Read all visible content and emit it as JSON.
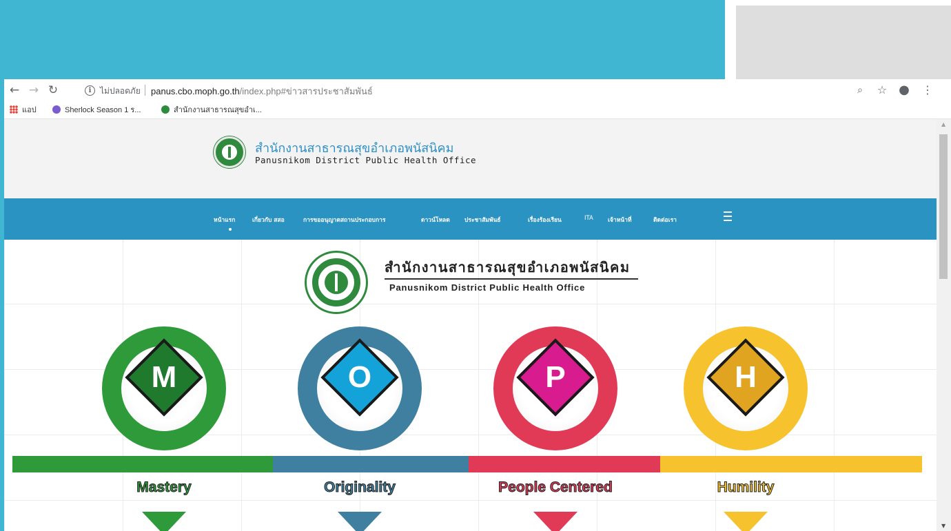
{
  "browser": {
    "security_label": "ไม่ปลอดภัย",
    "url_host": "panus.cbo.moph.go.th",
    "url_path": "/index.php#ข่าวสารประชาสัมพันธ์",
    "bookmarks": [
      {
        "label": "แอป"
      },
      {
        "label": "Sherlock Season 1 ร..."
      },
      {
        "label": "สำนักงานสาธารณสุขอำเ..."
      }
    ]
  },
  "site": {
    "title_th": "สำนักงานสาธารณสุขอำเภอพนัสนิคม",
    "title_en": "Panusnikom District Public Health Office",
    "menu": [
      {
        "label": "หน้าแรก"
      },
      {
        "label": "เกี่ยวกับ สสอ"
      },
      {
        "label": "การขออนุญาตสถานประกอบการ"
      },
      {
        "label": "ดาวน์โหลด"
      },
      {
        "label": "ประชาสัมพันธ์"
      },
      {
        "label": "เรื่องร้องเรียน"
      },
      {
        "label": "ITA"
      },
      {
        "label": "เจ้าหน้าที่"
      },
      {
        "label": "ติดต่อเรา"
      }
    ]
  },
  "banner": {
    "title_th": "สำนักงานสาธารณสุขอำเภอพนัสนิคม",
    "title_en": "Panusnikom District Public Health Office",
    "values": [
      {
        "letter": "M",
        "label": "Mastery",
        "color": "#2e9a3a",
        "diamond": "#1f7a2e"
      },
      {
        "letter": "O",
        "label": "Originality",
        "color": "#3f7f9f",
        "diamond": "#14a3d9"
      },
      {
        "letter": "P",
        "label": "People Centered",
        "color": "#e03a57",
        "diamond": "#d81b8f"
      },
      {
        "letter": "H",
        "label": "Humility",
        "color": "#f6c22d",
        "diamond": "#e0a420"
      }
    ]
  },
  "colors": {
    "slide_teal": "#41b6d2",
    "menu_blue": "#2b93c1",
    "brand_green": "#2f8a3e"
  }
}
